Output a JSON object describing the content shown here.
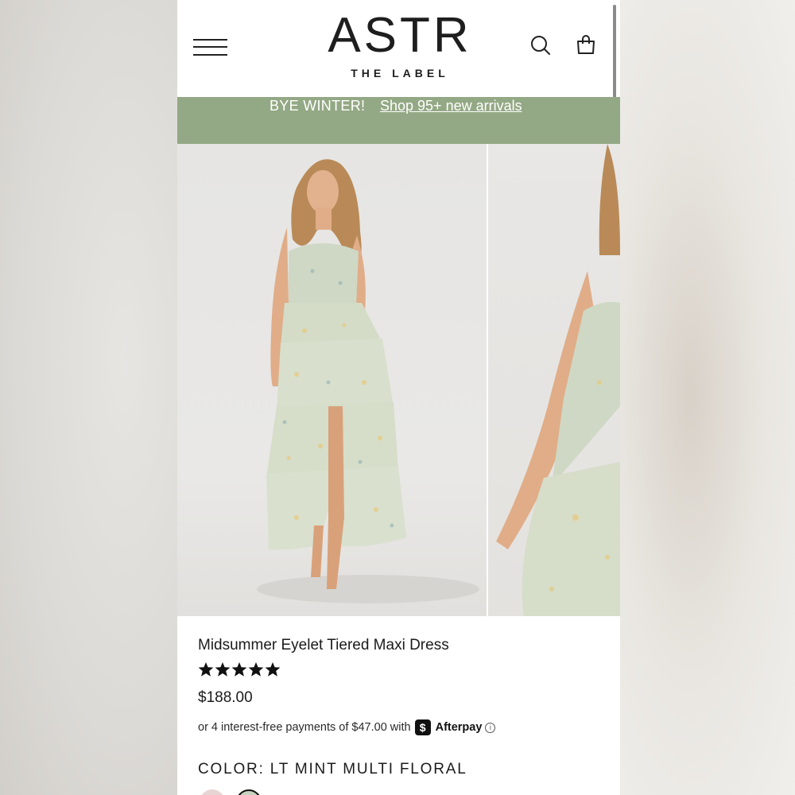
{
  "header": {
    "logo_main": "ASTR",
    "logo_sub": "THE LABEL"
  },
  "banner": {
    "message": "BYE WINTER!",
    "link": "Shop 95+ new arrivals",
    "color": "#93a884"
  },
  "product": {
    "title": "Midsummer Eyelet Tiered Maxi Dress",
    "rating": 5,
    "rating_max": 5,
    "price": "$188.00",
    "installment_prefix": "or 4 interest-free payments of $47.00 with",
    "installment_provider": "Afterpay",
    "color_label": "COLOR:",
    "color_value": "LT MINT MULTI FLORAL"
  },
  "icons": {
    "menu": "hamburger-menu-icon",
    "search": "search-icon",
    "bag": "shopping-bag-icon",
    "afterpay": "afterpay-logo-icon",
    "info": "info-icon",
    "star": "star-icon"
  }
}
